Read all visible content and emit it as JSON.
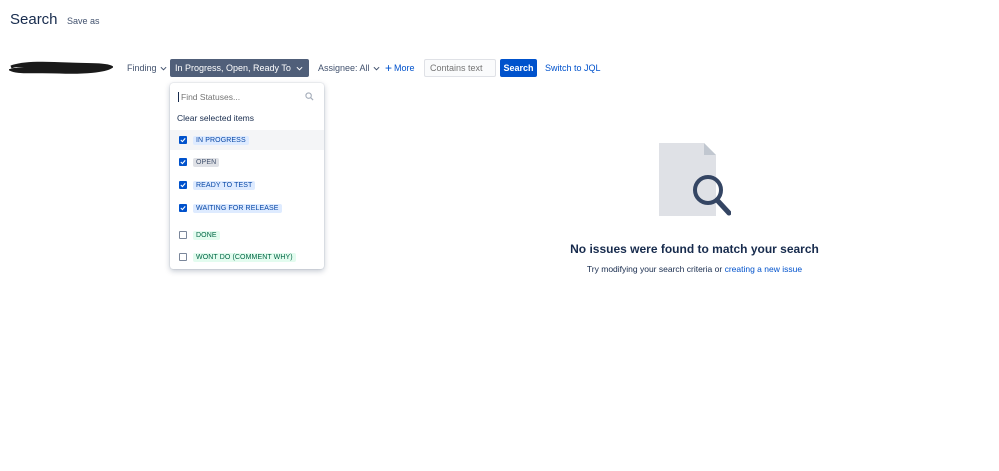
{
  "header": {
    "title": "Search",
    "save_as": "Save as"
  },
  "filters": {
    "project": "Finding",
    "status": "In Progress, Open, Ready To Te...",
    "assignee": "Assignee: All",
    "more": "More",
    "text_placeholder": "Contains text",
    "search": "Search",
    "switch_jql": "Switch to JQL"
  },
  "dropdown": {
    "find_placeholder": "Find Statuses...",
    "clear": "Clear selected items",
    "statuses": [
      {
        "label": "IN PROGRESS",
        "checked": true,
        "color": "blue"
      },
      {
        "label": "OPEN",
        "checked": true,
        "color": "grey"
      },
      {
        "label": "READY TO TEST",
        "checked": true,
        "color": "blue"
      },
      {
        "label": "WAITING FOR RELEASE",
        "checked": true,
        "color": "blue"
      },
      {
        "label": "DONE",
        "checked": false,
        "color": "green"
      },
      {
        "label": "WONT DO (COMMENT WHY)",
        "checked": false,
        "color": "green"
      }
    ]
  },
  "empty_state": {
    "title": "No issues were found to match your search",
    "subtitle": "Try modifying your search criteria or",
    "link": "creating a new issue"
  },
  "colors": {
    "primary": "#0052cc",
    "status_button_bg": "#505f79",
    "text": "#172b4d"
  }
}
